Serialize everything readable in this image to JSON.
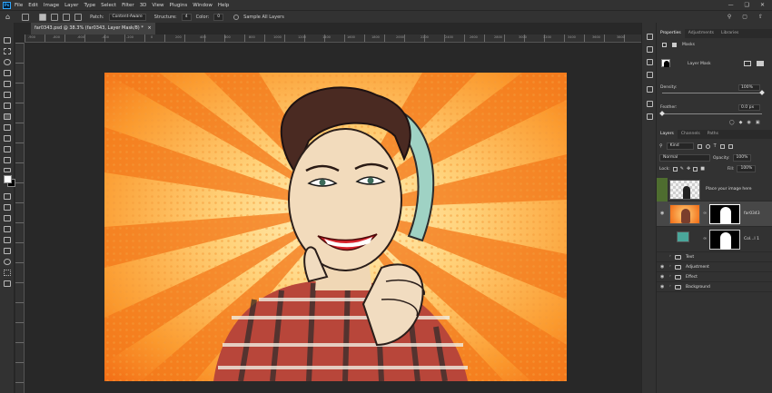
{
  "menubar": {
    "logo": "Ps",
    "items": [
      "File",
      "Edit",
      "Image",
      "Layer",
      "Type",
      "Select",
      "Filter",
      "3D",
      "View",
      "Plugins",
      "Window",
      "Help"
    ]
  },
  "options": {
    "patch_label": "Patch:",
    "patch_value": "Content-Aware",
    "structure_label": "Structure:",
    "structure_value": "4",
    "color_label": "Color:",
    "color_value": "0",
    "sample_label": "Sample All Layers"
  },
  "document": {
    "tab_title": "far0343.psd @ 38.3% (far0343, Layer Mask/8) *",
    "ruler_numbers": [
      "-900",
      "-800",
      "-600",
      "-400",
      "-200",
      "0",
      "200",
      "400",
      "600",
      "800",
      "1000",
      "1200",
      "1400",
      "1600",
      "1800",
      "2000",
      "2200",
      "2400",
      "2600",
      "2800",
      "3000",
      "3200",
      "3400",
      "3600",
      "3800"
    ]
  },
  "properties": {
    "tabs": [
      "Properties",
      "Adjustments",
      "Libraries"
    ],
    "masks_label": "Masks",
    "layer_mask_label": "Layer Mask",
    "density_label": "Density:",
    "density_value": "100%",
    "density_fraction": 1.0,
    "feather_label": "Feather:",
    "feather_value": "0.0 px",
    "feather_fraction": 0.0
  },
  "layers": {
    "tabs": [
      "Layers",
      "Channels",
      "Paths"
    ],
    "filter_kind": "Kind",
    "blend_mode": "Normal",
    "opacity_label": "Opacity:",
    "opacity_value": "100%",
    "lock_label": "Lock:",
    "fill_label": "Fill:",
    "fill_value": "100%",
    "items": [
      {
        "name": "Place your image here",
        "type": "smart",
        "visible": false
      },
      {
        "name": "far0343",
        "type": "image-mask",
        "visible": true
      },
      {
        "name": "Col...l 1",
        "type": "fill-mask",
        "visible": false
      },
      {
        "name": "Text",
        "type": "group",
        "visible": false
      },
      {
        "name": "Adjustment",
        "type": "group",
        "visible": true
      },
      {
        "name": "Effect",
        "type": "group",
        "visible": true
      },
      {
        "name": "Background",
        "type": "group",
        "visible": true
      }
    ]
  },
  "colors": {
    "accent": "#31a8ff",
    "burst_orange": "#f26a14",
    "burst_yellow": "#ffc766",
    "lips": "#d8242c"
  }
}
